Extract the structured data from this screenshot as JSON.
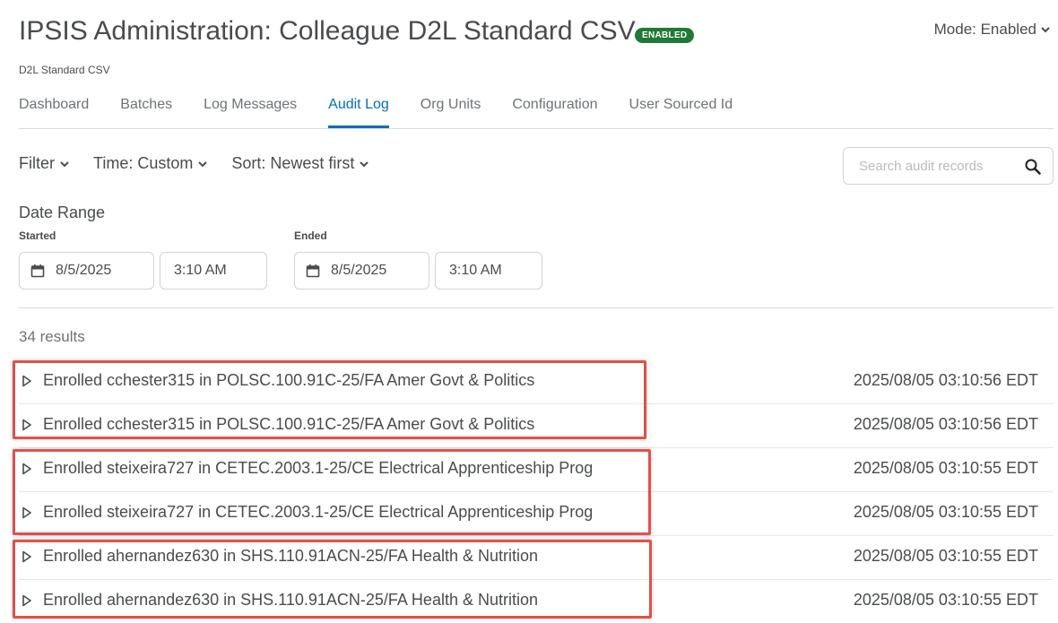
{
  "header": {
    "title": "IPSIS Administration: Colleague D2L Standard CSV",
    "badge": "ENABLED",
    "subtitle": "D2L Standard CSV",
    "mode": "Mode: Enabled"
  },
  "tabs": [
    {
      "label": "Dashboard"
    },
    {
      "label": "Batches"
    },
    {
      "label": "Log Messages"
    },
    {
      "label": "Audit Log",
      "active": true
    },
    {
      "label": "Org Units"
    },
    {
      "label": "Configuration"
    },
    {
      "label": "User Sourced Id"
    }
  ],
  "filters": {
    "filter": "Filter",
    "time": "Time: Custom",
    "sort": "Sort: Newest first"
  },
  "search": {
    "placeholder": "Search audit records"
  },
  "date_range": {
    "title": "Date Range",
    "started_label": "Started",
    "started_date": "8/5/2025",
    "started_time": "3:10 AM",
    "ended_label": "Ended",
    "ended_date": "8/5/2025",
    "ended_time": "3:10 AM"
  },
  "results": {
    "count": "34 results",
    "rows": [
      {
        "text": "Enrolled cchester315 in POLSC.100.91C-25/FA Amer Govt & Politics",
        "timestamp": "2025/08/05 03:10:56 EDT"
      },
      {
        "text": "Enrolled cchester315 in POLSC.100.91C-25/FA Amer Govt & Politics",
        "timestamp": "2025/08/05 03:10:56 EDT"
      },
      {
        "text": "Enrolled steixeira727 in CETEC.2003.1-25/CE Electrical Apprenticeship Prog",
        "timestamp": "2025/08/05 03:10:55 EDT"
      },
      {
        "text": "Enrolled steixeira727 in CETEC.2003.1-25/CE Electrical Apprenticeship Prog",
        "timestamp": "2025/08/05 03:10:55 EDT"
      },
      {
        "text": "Enrolled ahernandez630 in SHS.110.91ACN-25/FA Health & Nutrition",
        "timestamp": "2025/08/05 03:10:55 EDT"
      },
      {
        "text": "Enrolled ahernandez630 in SHS.110.91ACN-25/FA Health & Nutrition",
        "timestamp": "2025/08/05 03:10:55 EDT"
      }
    ]
  },
  "colors": {
    "accent": "#006fbf",
    "badge": "#1e7a36",
    "highlight": "#e0514a"
  },
  "icons": {
    "mode_chevron": "chevron-down-icon",
    "search": "search-icon",
    "calendar": "calendar-icon",
    "row_toggle": "triangle-right-icon"
  }
}
